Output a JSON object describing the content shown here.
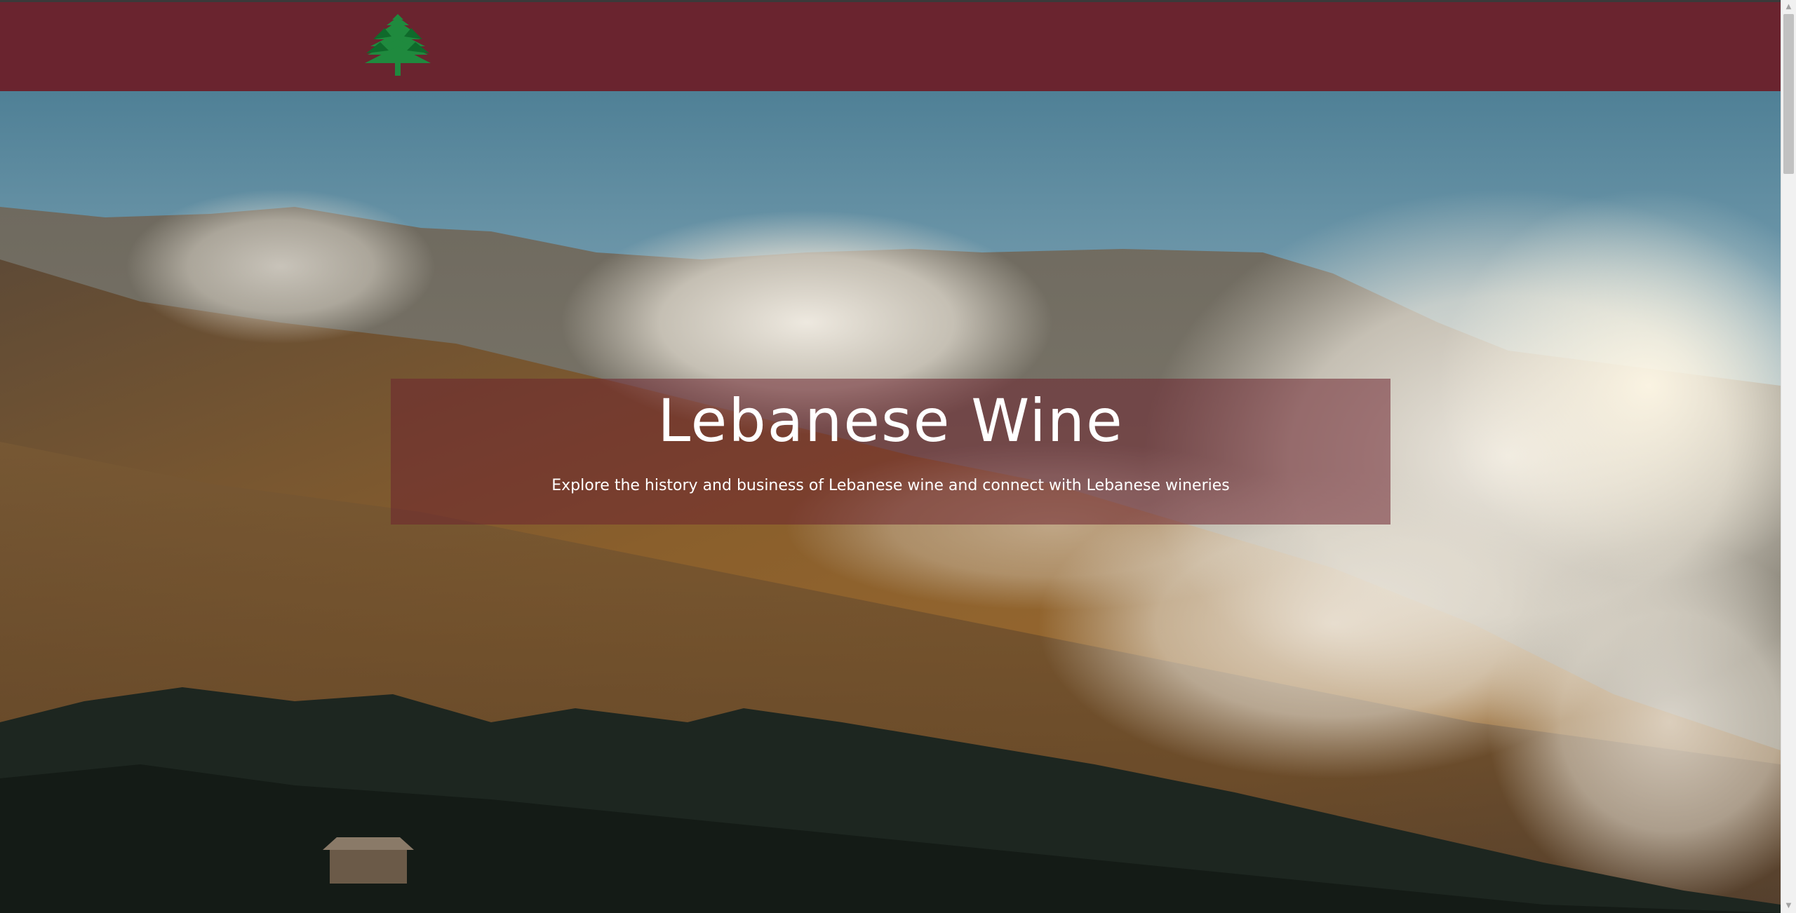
{
  "header": {
    "logo_icon": "cedar-tree-icon",
    "background_color": "#6a242f",
    "logo_color": "#1f8a3e"
  },
  "hero": {
    "title": "Lebanese Wine",
    "subtitle": "Explore the history and business of Lebanese wine and connect with Lebanese wineries",
    "background": "mountain-landscape-with-clouds-image",
    "card_color": "#6e2430"
  },
  "scrollbar": {
    "up_arrow": "▲",
    "down_arrow": "▼"
  }
}
